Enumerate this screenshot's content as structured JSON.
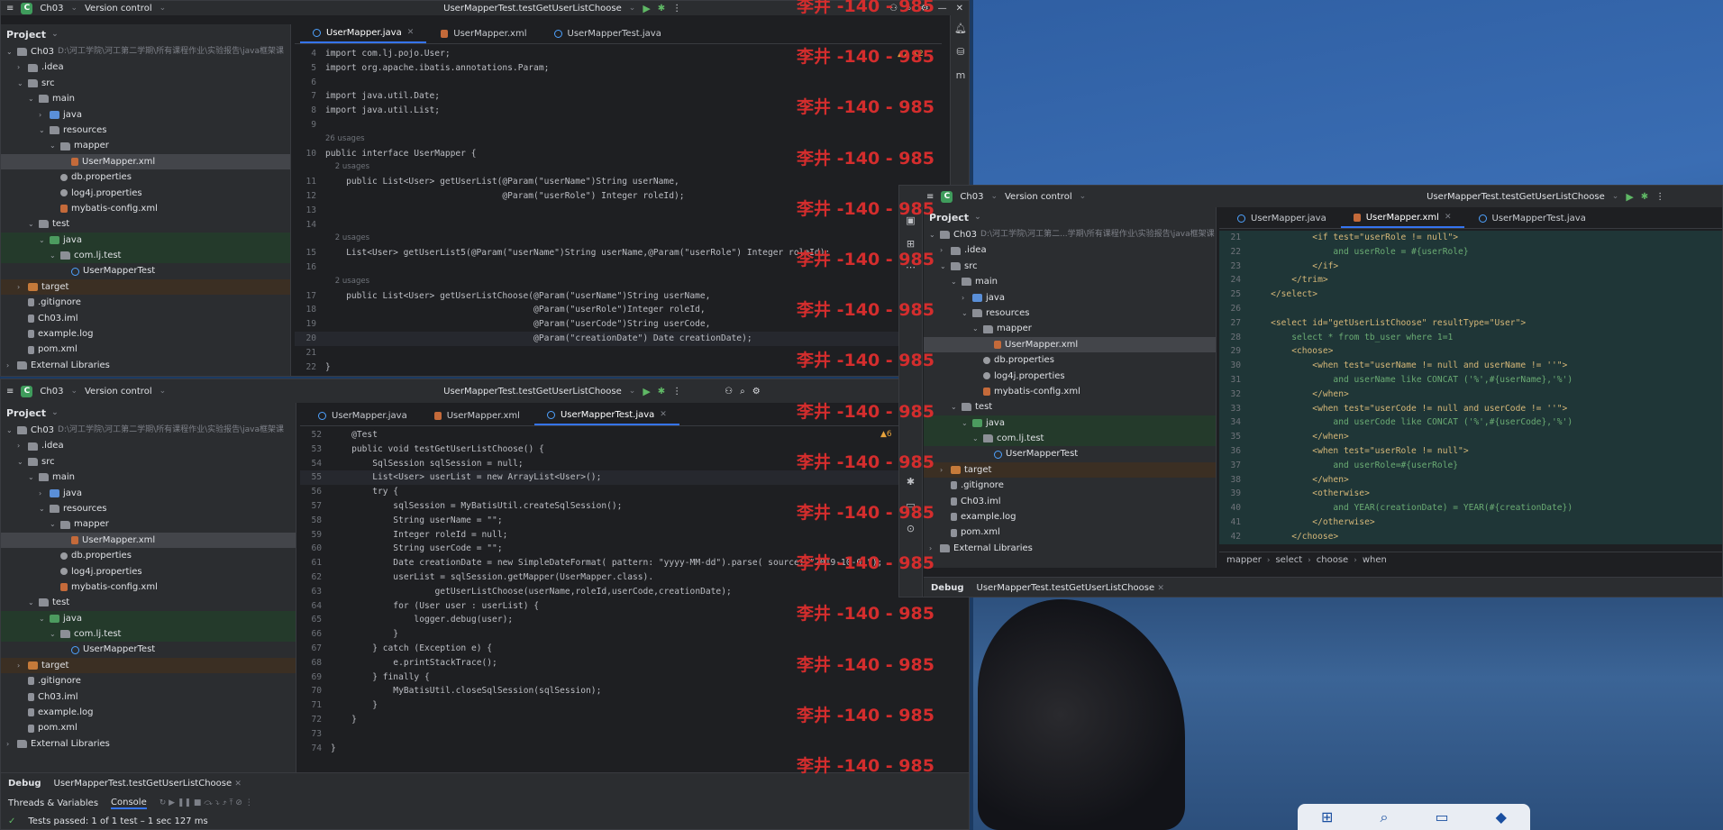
{
  "watermark": "李井 -140 - 985",
  "colors": {
    "accent": "#3574f0",
    "run": "#5fb865",
    "watermark": "#d42d2d"
  },
  "win1": {
    "project": "Ch03",
    "vcs": "Version control",
    "run_config": "UserMapperTest.testGetUserListChoose",
    "tabs": [
      "UserMapper.java",
      "UserMapper.xml",
      "UserMapperTest.java"
    ],
    "active_tab": 0,
    "panel_title": "Project",
    "root_path": "D:\\河工学院\\河工第二学期\\所有课程作业\\实验报告\\java框架课",
    "tree": [
      {
        "d": 1,
        "c": "v",
        "ico": "folder",
        "label": "Ch03"
      },
      {
        "d": 2,
        "c": ">",
        "ico": "folder",
        "label": ".idea"
      },
      {
        "d": 2,
        "c": "v",
        "ico": "folder",
        "label": "src"
      },
      {
        "d": 3,
        "c": "v",
        "ico": "folder",
        "label": "main"
      },
      {
        "d": 4,
        "c": ">",
        "ico": "src",
        "label": "java"
      },
      {
        "d": 4,
        "c": "v",
        "ico": "folder",
        "label": "resources"
      },
      {
        "d": 5,
        "c": "v",
        "ico": "folder",
        "label": "mapper"
      },
      {
        "d": 6,
        "c": "",
        "ico": "xml",
        "label": "UserMapper.xml",
        "sel": true
      },
      {
        "d": 5,
        "c": "",
        "ico": "prop",
        "label": "db.properties"
      },
      {
        "d": 5,
        "c": "",
        "ico": "prop",
        "label": "log4j.properties"
      },
      {
        "d": 5,
        "c": "",
        "ico": "xml",
        "label": "mybatis-config.xml"
      },
      {
        "d": 3,
        "c": "v",
        "ico": "folder",
        "label": "test"
      },
      {
        "d": 4,
        "c": "v",
        "ico": "green",
        "label": "java",
        "green": true
      },
      {
        "d": 5,
        "c": "v",
        "ico": "folder",
        "label": "com.lj.test",
        "green": true
      },
      {
        "d": 6,
        "c": "",
        "ico": "class",
        "label": "UserMapperTest"
      },
      {
        "d": 2,
        "c": ">",
        "ico": "orange",
        "label": "target",
        "orange": true
      },
      {
        "d": 2,
        "c": "",
        "ico": "file",
        "label": ".gitignore"
      },
      {
        "d": 2,
        "c": "",
        "ico": "file",
        "label": "Ch03.iml"
      },
      {
        "d": 2,
        "c": "",
        "ico": "file",
        "label": "example.log"
      },
      {
        "d": 2,
        "c": "",
        "ico": "file",
        "label": "pom.xml"
      },
      {
        "d": 1,
        "c": ">",
        "ico": "folder",
        "label": "External Libraries"
      }
    ],
    "warn": "▲2 ✕2",
    "code": [
      {
        "n": "4",
        "t": "import com.lj.pojo.User;"
      },
      {
        "n": "5",
        "t": "import org.apache.ibatis.annotations.Param;"
      },
      {
        "n": "6",
        "t": ""
      },
      {
        "n": "7",
        "t": "import java.util.Date;"
      },
      {
        "n": "8",
        "t": "import java.util.List;"
      },
      {
        "n": "9",
        "t": ""
      },
      {
        "n": "",
        "t": "26 usages"
      },
      {
        "n": "10",
        "t": "public interface UserMapper {"
      },
      {
        "n": "",
        "t": "    2 usages"
      },
      {
        "n": "11",
        "t": "    public List<User> getUserList(@Param(\"userName\")String userName,"
      },
      {
        "n": "12",
        "t": "                                  @Param(\"userRole\") Integer roleId);"
      },
      {
        "n": "13",
        "t": ""
      },
      {
        "n": "14",
        "t": ""
      },
      {
        "n": "",
        "t": "    2 usages"
      },
      {
        "n": "15",
        "t": "    List<User> getUserList5(@Param(\"userName\")String userName,@Param(\"userRole\") Integer roleId);"
      },
      {
        "n": "16",
        "t": ""
      },
      {
        "n": "",
        "t": "    2 usages"
      },
      {
        "n": "17",
        "t": "    public List<User> getUserListChoose(@Param(\"userName\")String userName,"
      },
      {
        "n": "18",
        "t": "                                        @Param(\"userRole\")Integer roleId,"
      },
      {
        "n": "19",
        "t": "                                        @Param(\"userCode\")String userCode,"
      },
      {
        "n": "20",
        "t": "                                        @Param(\"creationDate\") Date creationDate);",
        "hl": true
      },
      {
        "n": "21",
        "t": ""
      },
      {
        "n": "22",
        "t": "}"
      }
    ]
  },
  "win2": {
    "project": "Ch03",
    "vcs": "Version control",
    "run_config": "UserMapperTest.testGetUserListChoose",
    "tabs": [
      "UserMapper.java",
      "UserMapper.xml",
      "UserMapperTest.java"
    ],
    "active_tab": 2,
    "panel_title": "Project",
    "root_path": "D:\\河工学院\\河工第二学期\\所有课程作业\\实验报告\\java框架课",
    "warn": "▲6",
    "code": [
      {
        "n": "52",
        "t": "    @Test"
      },
      {
        "n": "53",
        "t": "    public void testGetUserListChoose() {"
      },
      {
        "n": "54",
        "t": "        SqlSession sqlSession = null;"
      },
      {
        "n": "55",
        "t": "        List<User> userList = new ArrayList<User>();",
        "hl": true
      },
      {
        "n": "56",
        "t": "        try {"
      },
      {
        "n": "57",
        "t": "            sqlSession = MyBatisUtil.createSqlSession();"
      },
      {
        "n": "58",
        "t": "            String userName = \"\";"
      },
      {
        "n": "59",
        "t": "            Integer roleId = null;"
      },
      {
        "n": "60",
        "t": "            String userCode = \"\";"
      },
      {
        "n": "61",
        "t": "            Date creationDate = new SimpleDateFormat( pattern: \"yyyy-MM-dd\").parse( source: \"2019-10-01\");"
      },
      {
        "n": "62",
        "t": "            userList = sqlSession.getMapper(UserMapper.class)."
      },
      {
        "n": "63",
        "t": "                    getUserListChoose(userName,roleId,userCode,creationDate);"
      },
      {
        "n": "64",
        "t": "            for (User user : userList) {"
      },
      {
        "n": "65",
        "t": "                logger.debug(user);"
      },
      {
        "n": "66",
        "t": "            }"
      },
      {
        "n": "67",
        "t": "        } catch (Exception e) {"
      },
      {
        "n": "68",
        "t": "            e.printStackTrace();"
      },
      {
        "n": "69",
        "t": "        } finally {"
      },
      {
        "n": "70",
        "t": "            MyBatisUtil.closeSqlSession(sqlSession);"
      },
      {
        "n": "71",
        "t": "        }"
      },
      {
        "n": "72",
        "t": "    }"
      },
      {
        "n": "73",
        "t": ""
      },
      {
        "n": "74",
        "t": "}"
      }
    ],
    "debug_label": "Debug",
    "debug_tab": "UserMapperTest.testGetUserListChoose",
    "threads_label": "Threads & Variables",
    "console_label": "Console",
    "status": "Tests passed: 1 of 1 test – 1 sec 127 ms"
  },
  "win3": {
    "project": "Ch03",
    "vcs": "Version control",
    "run_config": "UserMapperTest.testGetUserListChoose",
    "tabs": [
      "UserMapper.java",
      "UserMapper.xml",
      "UserMapperTest.java"
    ],
    "active_tab": 1,
    "panel_title": "Project",
    "root_path": "D:\\河工学院\\河工第二...学期\\所有课程作业\\实验报告\\java框架课",
    "code": [
      {
        "n": "21",
        "t": "            <if test=\"userRole != null\">"
      },
      {
        "n": "22",
        "t": "                and userRole = #{userRole}"
      },
      {
        "n": "23",
        "t": "            </if>"
      },
      {
        "n": "24",
        "t": "        </trim>"
      },
      {
        "n": "25",
        "t": "    </select>"
      },
      {
        "n": "26",
        "t": ""
      },
      {
        "n": "27",
        "t": "    <select id=\"getUserListChoose\" resultType=\"User\">"
      },
      {
        "n": "28",
        "t": "        select * from tb_user where 1=1"
      },
      {
        "n": "29",
        "t": "        <choose>"
      },
      {
        "n": "30",
        "t": "            <when test=\"userName != null and userName != ''\">"
      },
      {
        "n": "31",
        "t": "                and userName like CONCAT ('%',#{userName},'%')"
      },
      {
        "n": "32",
        "t": "            </when>"
      },
      {
        "n": "33",
        "t": "            <when test=\"userCode != null and userCode != ''\">"
      },
      {
        "n": "34",
        "t": "                and userCode like CONCAT ('%',#{userCode},'%')"
      },
      {
        "n": "35",
        "t": "            </when>"
      },
      {
        "n": "36",
        "t": "            <when test=\"userRole != null\">"
      },
      {
        "n": "37",
        "t": "                and userRole=#{userRole}"
      },
      {
        "n": "38",
        "t": "            </when>"
      },
      {
        "n": "39",
        "t": "            <otherwise>"
      },
      {
        "n": "40",
        "t": "                and YEAR(creationDate) = YEAR(#{creationDate})"
      },
      {
        "n": "41",
        "t": "            </otherwise>"
      },
      {
        "n": "42",
        "t": "        </choose>"
      }
    ],
    "breadcrumb": [
      "mapper",
      "select",
      "choose",
      "when"
    ],
    "debug_label": "Debug",
    "debug_tab": "UserMapperTest.testGetUserListChoose"
  }
}
